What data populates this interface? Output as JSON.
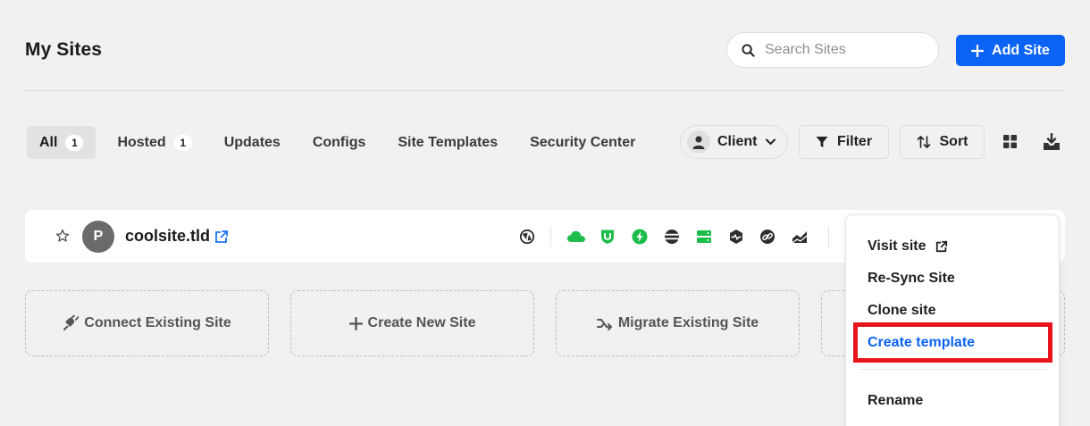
{
  "header": {
    "title": "My Sites",
    "search_placeholder": "Search Sites",
    "add_site_label": "Add Site"
  },
  "tabs": [
    {
      "label": "All",
      "count": "1",
      "active": true
    },
    {
      "label": "Hosted",
      "count": "1"
    },
    {
      "label": "Updates"
    },
    {
      "label": "Configs"
    },
    {
      "label": "Site Templates"
    },
    {
      "label": "Security Center"
    }
  ],
  "toolbar": {
    "client_label": "Client",
    "filter_label": "Filter",
    "sort_label": "Sort"
  },
  "site": {
    "avatar_letter": "P",
    "name": "coolsite.tld",
    "status_icons": [
      "wp-core-icon",
      "cloud-icon",
      "shield-icon",
      "bolt-icon",
      "database-icon",
      "server-icon",
      "uptime-icon",
      "link-icon",
      "analytics-icon"
    ]
  },
  "cards": [
    {
      "label": "Connect Existing Site",
      "icon": "plug-icon"
    },
    {
      "label": "Create New Site",
      "icon": "plus-icon"
    },
    {
      "label": "Migrate Existing Site",
      "icon": "migrate-icon"
    }
  ],
  "menu": {
    "items": [
      {
        "label": "Visit site"
      },
      {
        "label": "Re-Sync Site"
      },
      {
        "label": "Clone site"
      },
      {
        "label": "Create template",
        "highlighted": true
      },
      {
        "label": "Rename"
      }
    ]
  },
  "colors": {
    "accent": "#0b63f6",
    "status_green": "#1ebd4b",
    "highlight_red": "#e8141c"
  }
}
